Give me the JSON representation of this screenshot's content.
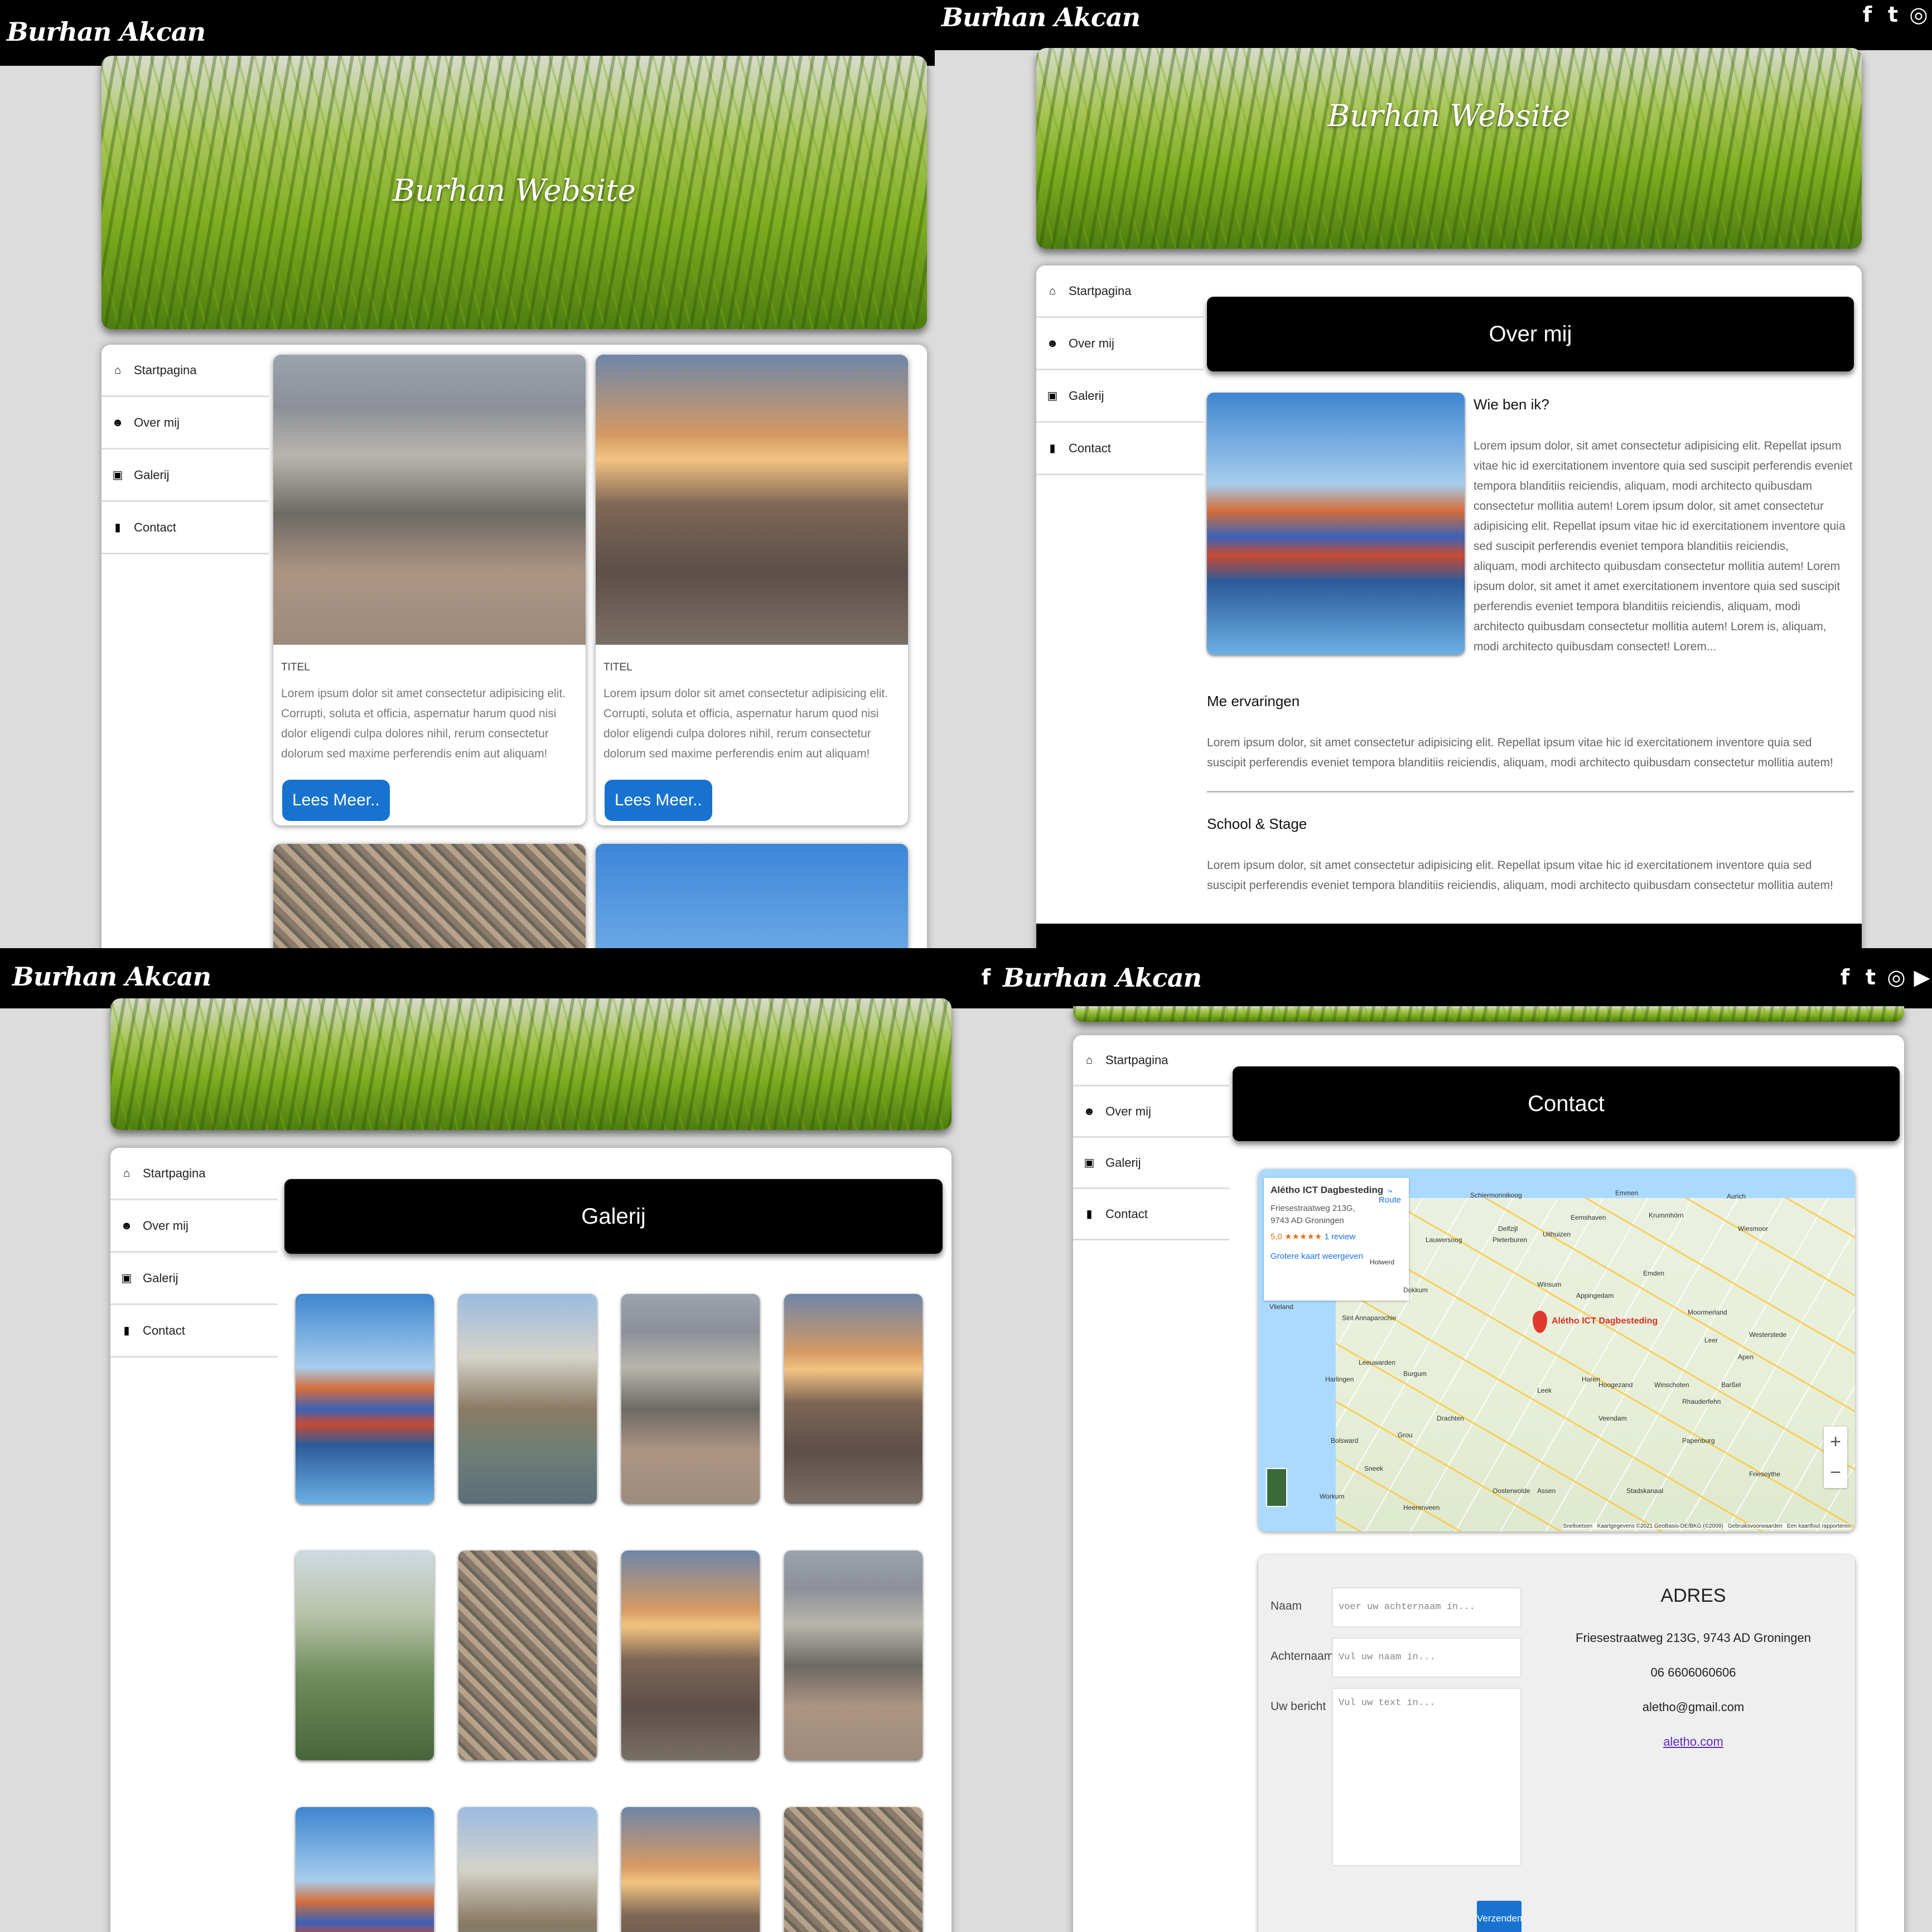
{
  "brand": "Burhan Akcan",
  "site_title": "Burhan Website",
  "nav": [
    "Startpagina",
    "Over mij",
    "Galerij",
    "Contact"
  ],
  "home": {
    "cards": [
      {
        "title": "TITEL",
        "text": "Lorem ipsum dolor sit amet consectetur adipisicing elit. Corrupti, soluta et officia, aspernatur harum quod nisi dolor eligendi culpa dolores nihil, rerum consectetur dolorum sed maxime perferendis enim aut aliquam!",
        "button": "Lees Meer.."
      },
      {
        "title": "TITEL",
        "text": "Lorem ipsum dolor sit amet consectetur adipisicing elit. Corrupti, soluta et officia, aspernatur harum quod nisi dolor eligendi culpa dolores nihil, rerum consectetur dolorum sed maxime perferendis enim aut aliquam!",
        "button": "Lees Meer.."
      }
    ]
  },
  "about": {
    "heading": "Over mij",
    "who_title": "Wie ben ik?",
    "who_p1": "Lorem ipsum dolor, sit amet consectetur adipisicing elit. Repellat ipsum vitae hic id exercitationem inventore quia sed suscipit perferendis eveniet tempora blanditiis reiciendis, aliquam, modi architecto quibusdam consectetur mollitia autem! Lorem ipsum dolor, sit amet consectetur adipisicing elit. Repellat ipsum vitae hic id exercitationem inventore quia sed suscipit perferendis eveniet tempora blanditiis reiciendis,",
    "who_p2": "aliquam, modi architecto quibusdam consectetur mollitia autem! Lorem ipsum dolor, sit amet it amet exercitationem inventore quia sed suscipit perferendis eveniet tempora blanditiis reiciendis, aliquam, modi architecto quibusdam consectetur mollitia autem! Lorem is, aliquam, modi architecto quibusdam consectet! Lorem...",
    "exp_title": "Me ervaringen",
    "exp_text": "Lorem ipsum dolor, sit amet consectetur adipisicing elit. Repellat ipsum vitae hic id exercitationem inventore quia sed suscipit perferendis eveniet tempora blanditiis reiciendis, aliquam, modi architecto quibusdam consectetur mollitia autem!",
    "school_title": "School & Stage",
    "school_text": "Lorem ipsum dolor, sit amet consectetur adipisicing elit. Repellat ipsum vitae hic id exercitationem inventore quia sed suscipit perferendis eveniet tempora blanditiis reiciendis, aliquam, modi architecto quibusdam consectetur mollitia autem!"
  },
  "gallery": {
    "heading": "Galerij"
  },
  "contact": {
    "heading": "Contact",
    "map": {
      "place": "Alétho ICT Dagbesteding",
      "address": "Friesestraatweg 213G, 9743 AD Groningen",
      "rating": "5,0",
      "stars": "★★★★★",
      "reviews": "1 review",
      "route": "Route",
      "bigger": "Grotere kaart weergeven",
      "pin_label": "Alétho ICT Dagbesteding",
      "zoom_in": "+",
      "zoom_out": "−",
      "footer": "Sneltoetsen   Kaartgegevens ©2021 GeoBasis-DE/BKG (©2009)   Gebruiksvoorwaarden   Een kaartfout rapporteren",
      "places": [
        "Schiermonnikoog",
        "Emmen",
        "Aurich",
        "Lauwersoog",
        "Pieterburen",
        "Uithuizen",
        "Eemshaven",
        "Krummhörn",
        "Holwerd",
        "Dokkum",
        "Winsum",
        "Appingedam",
        "Delfzijl",
        "Emden",
        "Wiesmoor",
        "Leer",
        "Westerstede",
        "Sint Annaparochie",
        "Leeuwarden",
        "Burgum",
        "Haren",
        "Harlingen",
        "Hoogezand",
        "Winschoten",
        "Rhauderfehn",
        "Drachten",
        "Leek",
        "Veendam",
        "Papenburg",
        "Bolsward",
        "Grou",
        "Sneek",
        "Stadskanaal",
        "Oosterwolde",
        "Assen",
        "Heerenveen",
        "Workum",
        "Vlieland",
        "Friesoythe",
        "Barßel",
        "Apen",
        "Moormerland"
      ]
    },
    "form": {
      "naam_label": "Naam",
      "naam_placeholder": "voer uw achternaam in...",
      "achternaam_label": "Achternaam",
      "achternaam_placeholder": "Vul uw naam in...",
      "bericht_label": "Uw bericht",
      "bericht_placeholder": "Vul uw text in...",
      "submit": "Verzenden"
    },
    "address": {
      "title": "ADRES",
      "street": "Friesestraatweg 213G, 9743 AD Groningen",
      "phone": "06 6606060606",
      "email": "aletho@gmail.com",
      "website": "aletho.com"
    }
  }
}
